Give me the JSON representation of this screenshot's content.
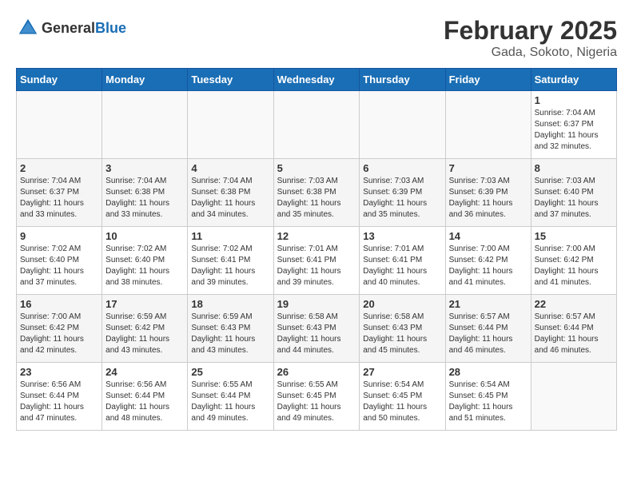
{
  "header": {
    "logo_general": "General",
    "logo_blue": "Blue",
    "title": "February 2025",
    "subtitle": "Gada, Sokoto, Nigeria"
  },
  "calendar": {
    "days_of_week": [
      "Sunday",
      "Monday",
      "Tuesday",
      "Wednesday",
      "Thursday",
      "Friday",
      "Saturday"
    ],
    "weeks": [
      [
        {
          "day": "",
          "info": ""
        },
        {
          "day": "",
          "info": ""
        },
        {
          "day": "",
          "info": ""
        },
        {
          "day": "",
          "info": ""
        },
        {
          "day": "",
          "info": ""
        },
        {
          "day": "",
          "info": ""
        },
        {
          "day": "1",
          "info": "Sunrise: 7:04 AM\nSunset: 6:37 PM\nDaylight: 11 hours and 32 minutes."
        }
      ],
      [
        {
          "day": "2",
          "info": "Sunrise: 7:04 AM\nSunset: 6:37 PM\nDaylight: 11 hours and 33 minutes."
        },
        {
          "day": "3",
          "info": "Sunrise: 7:04 AM\nSunset: 6:38 PM\nDaylight: 11 hours and 33 minutes."
        },
        {
          "day": "4",
          "info": "Sunrise: 7:04 AM\nSunset: 6:38 PM\nDaylight: 11 hours and 34 minutes."
        },
        {
          "day": "5",
          "info": "Sunrise: 7:03 AM\nSunset: 6:38 PM\nDaylight: 11 hours and 35 minutes."
        },
        {
          "day": "6",
          "info": "Sunrise: 7:03 AM\nSunset: 6:39 PM\nDaylight: 11 hours and 35 minutes."
        },
        {
          "day": "7",
          "info": "Sunrise: 7:03 AM\nSunset: 6:39 PM\nDaylight: 11 hours and 36 minutes."
        },
        {
          "day": "8",
          "info": "Sunrise: 7:03 AM\nSunset: 6:40 PM\nDaylight: 11 hours and 37 minutes."
        }
      ],
      [
        {
          "day": "9",
          "info": "Sunrise: 7:02 AM\nSunset: 6:40 PM\nDaylight: 11 hours and 37 minutes."
        },
        {
          "day": "10",
          "info": "Sunrise: 7:02 AM\nSunset: 6:40 PM\nDaylight: 11 hours and 38 minutes."
        },
        {
          "day": "11",
          "info": "Sunrise: 7:02 AM\nSunset: 6:41 PM\nDaylight: 11 hours and 39 minutes."
        },
        {
          "day": "12",
          "info": "Sunrise: 7:01 AM\nSunset: 6:41 PM\nDaylight: 11 hours and 39 minutes."
        },
        {
          "day": "13",
          "info": "Sunrise: 7:01 AM\nSunset: 6:41 PM\nDaylight: 11 hours and 40 minutes."
        },
        {
          "day": "14",
          "info": "Sunrise: 7:00 AM\nSunset: 6:42 PM\nDaylight: 11 hours and 41 minutes."
        },
        {
          "day": "15",
          "info": "Sunrise: 7:00 AM\nSunset: 6:42 PM\nDaylight: 11 hours and 41 minutes."
        }
      ],
      [
        {
          "day": "16",
          "info": "Sunrise: 7:00 AM\nSunset: 6:42 PM\nDaylight: 11 hours and 42 minutes."
        },
        {
          "day": "17",
          "info": "Sunrise: 6:59 AM\nSunset: 6:42 PM\nDaylight: 11 hours and 43 minutes."
        },
        {
          "day": "18",
          "info": "Sunrise: 6:59 AM\nSunset: 6:43 PM\nDaylight: 11 hours and 43 minutes."
        },
        {
          "day": "19",
          "info": "Sunrise: 6:58 AM\nSunset: 6:43 PM\nDaylight: 11 hours and 44 minutes."
        },
        {
          "day": "20",
          "info": "Sunrise: 6:58 AM\nSunset: 6:43 PM\nDaylight: 11 hours and 45 minutes."
        },
        {
          "day": "21",
          "info": "Sunrise: 6:57 AM\nSunset: 6:44 PM\nDaylight: 11 hours and 46 minutes."
        },
        {
          "day": "22",
          "info": "Sunrise: 6:57 AM\nSunset: 6:44 PM\nDaylight: 11 hours and 46 minutes."
        }
      ],
      [
        {
          "day": "23",
          "info": "Sunrise: 6:56 AM\nSunset: 6:44 PM\nDaylight: 11 hours and 47 minutes."
        },
        {
          "day": "24",
          "info": "Sunrise: 6:56 AM\nSunset: 6:44 PM\nDaylight: 11 hours and 48 minutes."
        },
        {
          "day": "25",
          "info": "Sunrise: 6:55 AM\nSunset: 6:44 PM\nDaylight: 11 hours and 49 minutes."
        },
        {
          "day": "26",
          "info": "Sunrise: 6:55 AM\nSunset: 6:45 PM\nDaylight: 11 hours and 49 minutes."
        },
        {
          "day": "27",
          "info": "Sunrise: 6:54 AM\nSunset: 6:45 PM\nDaylight: 11 hours and 50 minutes."
        },
        {
          "day": "28",
          "info": "Sunrise: 6:54 AM\nSunset: 6:45 PM\nDaylight: 11 hours and 51 minutes."
        },
        {
          "day": "",
          "info": ""
        }
      ]
    ]
  }
}
